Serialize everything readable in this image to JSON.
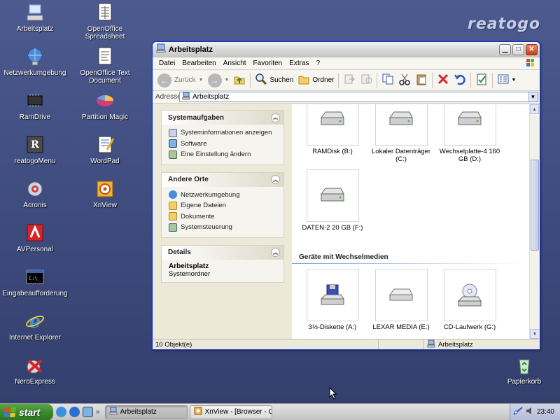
{
  "desktop": {
    "brand": "reatogo",
    "icons": [
      {
        "label": "Arbeitsplatz",
        "icon": "my-computer-icon"
      },
      {
        "label": "OpenOffice Spreadsheet",
        "icon": "spreadsheet-icon"
      },
      {
        "label": "Netzwerkumgebung",
        "icon": "network-icon"
      },
      {
        "label": "OpenOffice Text Document",
        "icon": "text-document-icon"
      },
      {
        "label": "RamDrive",
        "icon": "ram-chip-icon"
      },
      {
        "label": "Partition Magic",
        "icon": "pie-chart-icon"
      },
      {
        "label": "reatogoMenu",
        "icon": "reatogo-menu-icon"
      },
      {
        "label": "WordPad",
        "icon": "wordpad-icon"
      },
      {
        "label": "Acronis",
        "icon": "acronis-icon"
      },
      {
        "label": "XnView",
        "icon": "xnview-icon"
      },
      {
        "label": "AVPersonal",
        "icon": "antivirus-icon"
      },
      {
        "label": "Eingabeaufforderung",
        "icon": "command-prompt-icon"
      },
      {
        "label": "Internet Explorer",
        "icon": "internet-explorer-icon"
      },
      {
        "label": "NeroExpress",
        "icon": "nero-icon"
      },
      {
        "label": "Papierkorb",
        "icon": "recycle-bin-icon"
      }
    ]
  },
  "window": {
    "title": "Arbeitsplatz",
    "menu": [
      "Datei",
      "Bearbeiten",
      "Ansicht",
      "Favoriten",
      "Extras",
      "?"
    ],
    "toolbar": {
      "back_label": "Zurück",
      "search_label": "Suchen",
      "folders_label": "Ordner"
    },
    "address": {
      "label": "Adresse",
      "value": "Arbeitsplatz"
    },
    "tasks": {
      "system": {
        "title": "Systemaufgaben",
        "items": [
          "Systeminformationen anzeigen",
          "Software",
          "Eine Einstellung ändern"
        ]
      },
      "places": {
        "title": "Andere Orte",
        "items": [
          "Netzwerkumgebung",
          "Eigene Dateien",
          "Dokumente",
          "Systemsteuerung"
        ]
      },
      "details": {
        "title": "Details",
        "name": "Arbeitsplatz",
        "type": "Systemordner"
      }
    },
    "drives": [
      {
        "label": "RAMDisk (B:)"
      },
      {
        "label": "Lokaler Datenträger (C:)"
      },
      {
        "label": "Wechselplatte-4 160 GB (D:)"
      },
      {
        "label": "DATEN-2  20 GB (F:)"
      }
    ],
    "removable_group": "Geräte mit Wechselmedien",
    "removable": [
      {
        "label": "3½-Diskette (A:)"
      },
      {
        "label": "LEXAR MEDIA (E:)"
      },
      {
        "label": "CD-Laufwerk (G:)"
      }
    ],
    "status": {
      "count": "10 Objekt(e)",
      "location": "Arbeitsplatz"
    }
  },
  "taskbar": {
    "start_label": "start",
    "tasks": [
      "Arbeitsplatz",
      "XnView - [Browser - C:\\]"
    ],
    "clock": "23:40"
  }
}
